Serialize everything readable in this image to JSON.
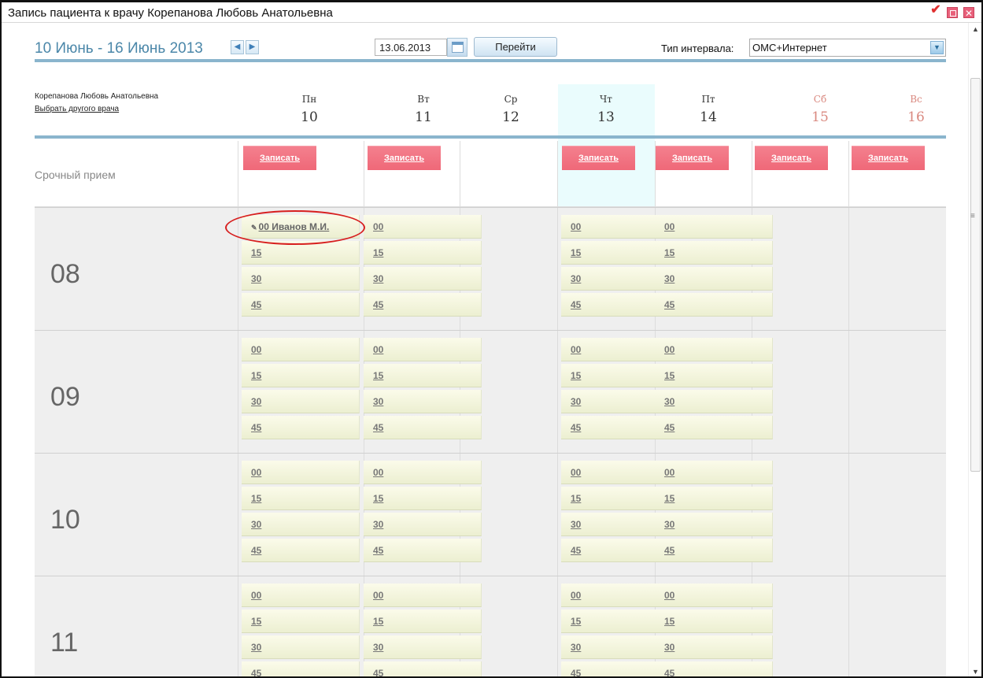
{
  "window": {
    "title": "Запись пациента к врачу Корепанова Любовь Анатольевна"
  },
  "toolbar": {
    "date_range": "10 Июнь - 16 Июнь 2013",
    "date_value": "13.06.2013",
    "go_label": "Перейти",
    "interval_label": "Тип интервала:",
    "interval_value": "ОМС+Интернет"
  },
  "doctor": {
    "name": "Корепанова Любовь Анатольевна",
    "change_link": "Выбрать другого врача"
  },
  "days": [
    {
      "name": "Пн",
      "num": "10"
    },
    {
      "name": "Вт",
      "num": "11"
    },
    {
      "name": "Ср",
      "num": "12"
    },
    {
      "name": "Чт",
      "num": "13"
    },
    {
      "name": "Пт",
      "num": "14"
    },
    {
      "name": "Сб",
      "num": "15"
    },
    {
      "name": "Вс",
      "num": "16"
    }
  ],
  "urgent": {
    "label": "Срочный прием",
    "button_label": "Записать"
  },
  "hours": [
    "08",
    "09",
    "10",
    "11"
  ],
  "minutes": [
    "00",
    "15",
    "30",
    "45"
  ],
  "booking": {
    "label": "00 Иванов М.И."
  },
  "colors": {
    "accent": "#4b87a9",
    "urgent_button": "#ef6878",
    "today_column": "#eafcfd",
    "weekend_text": "#d9887f",
    "highlight": "#d71f1f"
  }
}
